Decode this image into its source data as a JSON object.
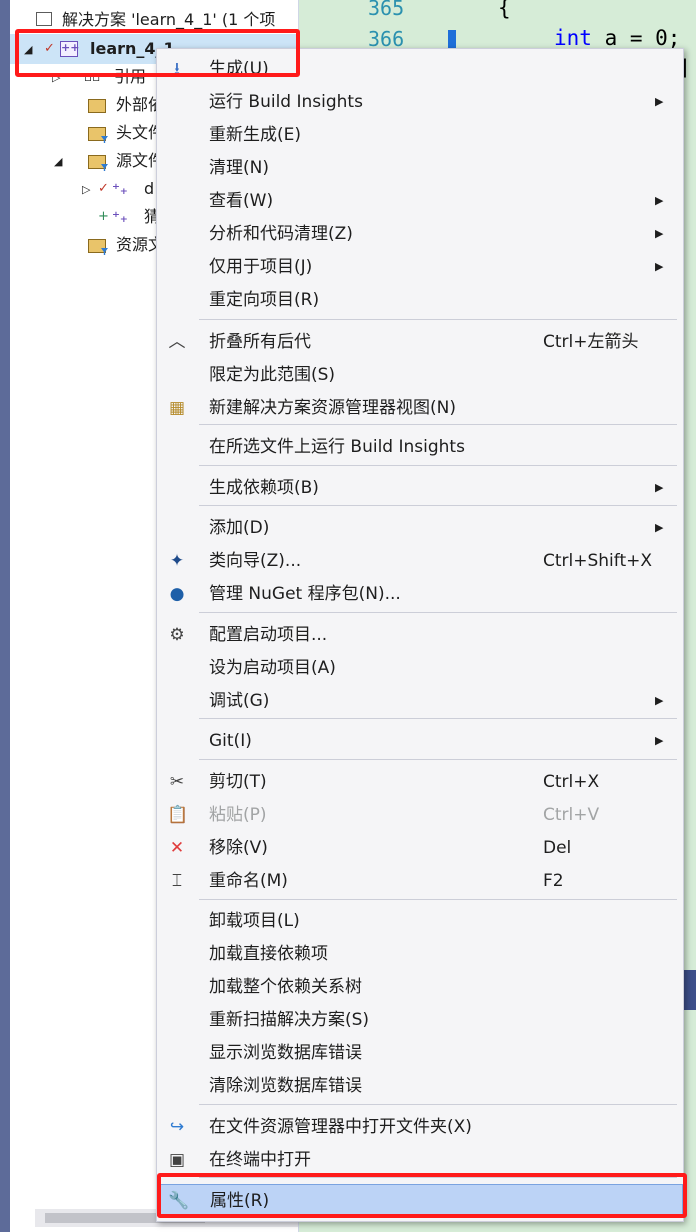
{
  "explorer": {
    "solution_label": "解决方案 'learn_4_1' (1 个项",
    "project_label": "learn_4_1",
    "items": [
      {
        "label": "引用"
      },
      {
        "label": "外部依"
      },
      {
        "label": "头文件"
      },
      {
        "label": "源文件"
      },
      {
        "label": "d"
      },
      {
        "label": "猜"
      },
      {
        "label": "资源文"
      }
    ]
  },
  "editor": {
    "line_numbers": [
      "365",
      "366"
    ],
    "line1": "{",
    "line2_kw": "int",
    "line2_rest": " a = 0;",
    "line3": "]"
  },
  "menu": {
    "items": [
      {
        "label": "生成(U)",
        "icon": "build-icon"
      },
      {
        "label": "运行 Build Insights",
        "submenu": true
      },
      {
        "label": "重新生成(E)"
      },
      {
        "label": "清理(N)"
      },
      {
        "label": "查看(W)",
        "submenu": true
      },
      {
        "label": "分析和代码清理(Z)",
        "submenu": true
      },
      {
        "label": "仅用于项目(J)",
        "submenu": true
      },
      {
        "label": "重定向项目(R)"
      },
      {
        "label": "折叠所有后代",
        "shortcut": "Ctrl+左箭头",
        "icon": "collapse-icon"
      },
      {
        "label": "限定为此范围(S)"
      },
      {
        "label": "新建解决方案资源管理器视图(N)",
        "icon": "new-view-icon"
      },
      {
        "label": "在所选文件上运行 Build Insights"
      },
      {
        "label": "生成依赖项(B)",
        "submenu": true
      },
      {
        "label": "添加(D)",
        "submenu": true
      },
      {
        "label": "类向导(Z)...",
        "shortcut": "Ctrl+Shift+X",
        "icon": "class-wizard-icon"
      },
      {
        "label": "管理 NuGet 程序包(N)...",
        "icon": "nuget-icon"
      },
      {
        "label": "配置启动项目...",
        "icon": "gear-icon"
      },
      {
        "label": "设为启动项目(A)"
      },
      {
        "label": "调试(G)",
        "submenu": true
      },
      {
        "label": "Git(I)",
        "submenu": true
      },
      {
        "label": "剪切(T)",
        "shortcut": "Ctrl+X",
        "icon": "scissors-icon"
      },
      {
        "label": "粘贴(P)",
        "shortcut": "Ctrl+V",
        "icon": "paste-icon",
        "disabled": true
      },
      {
        "label": "移除(V)",
        "shortcut": "Del",
        "icon": "remove-icon"
      },
      {
        "label": "重命名(M)",
        "shortcut": "F2",
        "icon": "rename-icon"
      },
      {
        "label": "卸载项目(L)"
      },
      {
        "label": "加载直接依赖项"
      },
      {
        "label": "加载整个依赖关系树"
      },
      {
        "label": "重新扫描解决方案(S)"
      },
      {
        "label": "显示浏览数据库错误"
      },
      {
        "label": "清除浏览数据库错误"
      },
      {
        "label": "在文件资源管理器中打开文件夹(X)",
        "icon": "open-folder-icon"
      },
      {
        "label": "在终端中打开",
        "icon": "terminal-icon"
      },
      {
        "label": "属性(R)",
        "icon": "wrench-icon",
        "highlighted": true
      }
    ]
  },
  "colors": {
    "annotation_red": "#ff1a1a",
    "menu_highlight": "#bcd3f6",
    "editor_bg": "#d6ecd7"
  }
}
